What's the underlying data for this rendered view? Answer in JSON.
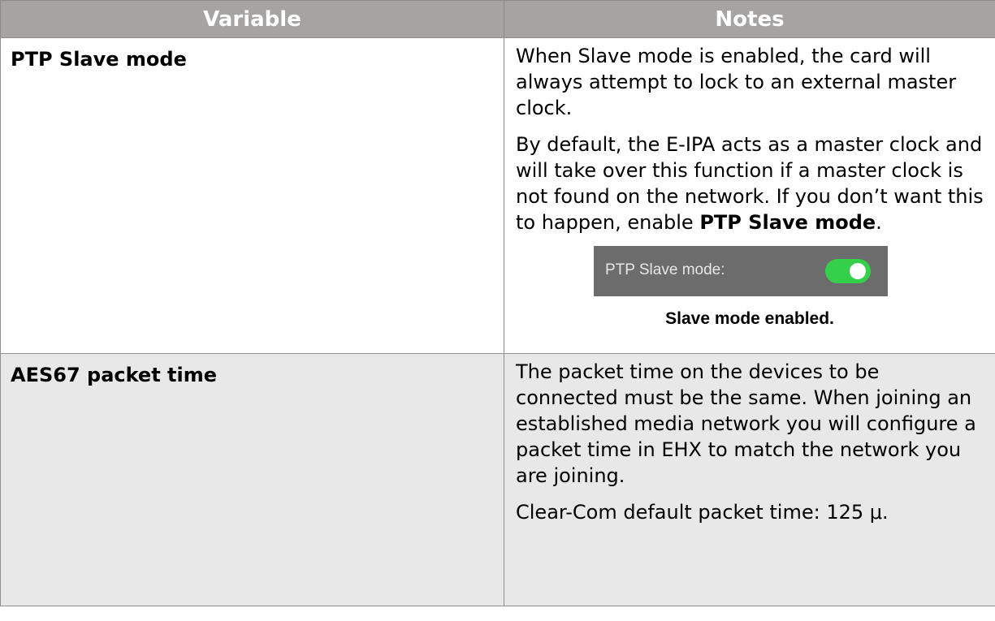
{
  "headers": {
    "variable": "Variable",
    "notes": "Notes"
  },
  "rows": [
    {
      "variable": "PTP Slave mode",
      "notes": {
        "p1": "When Slave mode is enabled, the card will always attempt to lock to an external master clock.",
        "p2_text": "By default, the E-IPA acts as a master clock and will take over this function if a master clock is not found on the network. If you don’t want this to happen, enable ",
        "p2_bold": "PTP Slave mode",
        "p2_end": ".",
        "screenshot_label": "PTP Slave mode:",
        "toggle_state": "on",
        "caption": "Slave mode enabled."
      }
    },
    {
      "variable": "AES67 packet time",
      "notes": {
        "p1": "The packet time on the devices to be connected must be the same. When joining an established media network you will configure a packet time in EHX to match the network you are joining.",
        "p2": "Clear-Com default packet time: 125 μ."
      }
    }
  ],
  "colors": {
    "header_bg": "#a6a4a2",
    "row_alt_bg": "#e8e8e8",
    "toggle_on": "#35d04a",
    "screenshot_bg": "#6c6c6c"
  }
}
